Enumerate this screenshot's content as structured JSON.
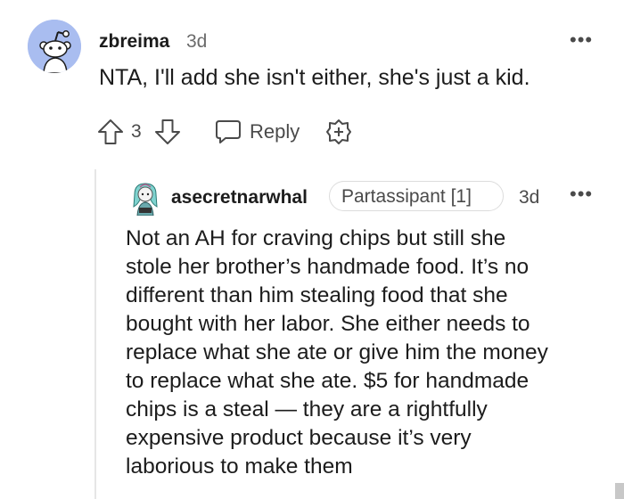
{
  "comment": {
    "username": "zbreima",
    "time": "3d",
    "body": "NTA, I'll add she isn't either, she's just a kid.",
    "score": "3",
    "reply_label": "Reply",
    "more": "•••",
    "avatar_icon": "snoo-avatar",
    "avatar_color": "#a9bdf0"
  },
  "reply": {
    "username": "asecretnarwhal",
    "flair": "Partassipant [1]",
    "time": "3d",
    "more": "•••",
    "avatar_icon": "custom-avatar",
    "body_lines": [
      "Not an AH for craving chips but still she",
      "stole her brother’s handmade food. It’s no",
      "different than him stealing food that she",
      "bought with her labor. She either needs to",
      "replace what she ate or give him the money",
      "to replace what she ate. $5 for handmade",
      "chips is a steal — they are a rightfully",
      "expensive product because it’s very",
      "laborious to make them"
    ]
  }
}
